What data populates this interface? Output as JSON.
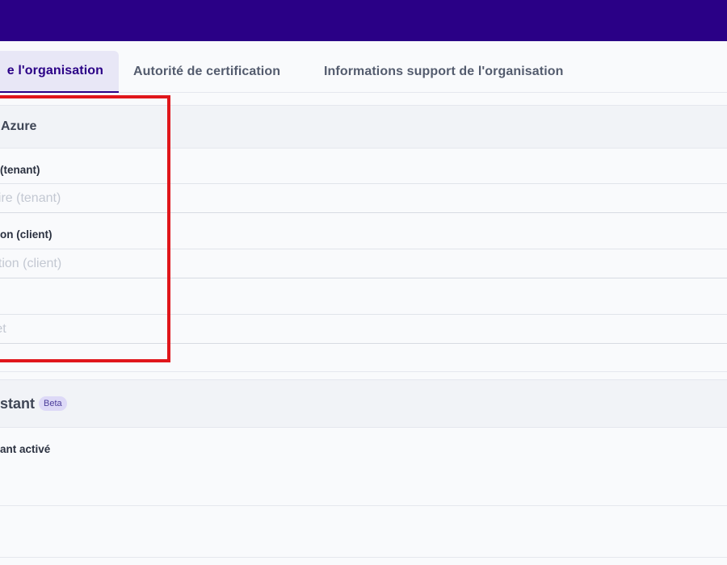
{
  "tabs": [
    {
      "label": "e l'organisation",
      "active": true
    },
    {
      "label": "Autorité de certification",
      "active": false
    },
    {
      "label": "Informations support de l'organisation",
      "active": false
    }
  ],
  "azure_section": {
    "title": "Azure",
    "fields": [
      {
        "label": "(tenant)",
        "placeholder": "aire (tenant)"
      },
      {
        "label": "on (client)",
        "placeholder": "ation (client)"
      },
      {
        "label": "",
        "placeholder": "ret"
      }
    ]
  },
  "assistant_section": {
    "title": "stant",
    "badge": "Beta",
    "toggle_label": "ant activé"
  },
  "colors": {
    "topbar": "#2a0086",
    "accent": "#2a0086",
    "highlight": "#e0161b",
    "badge_bg": "#ddd9f7"
  }
}
